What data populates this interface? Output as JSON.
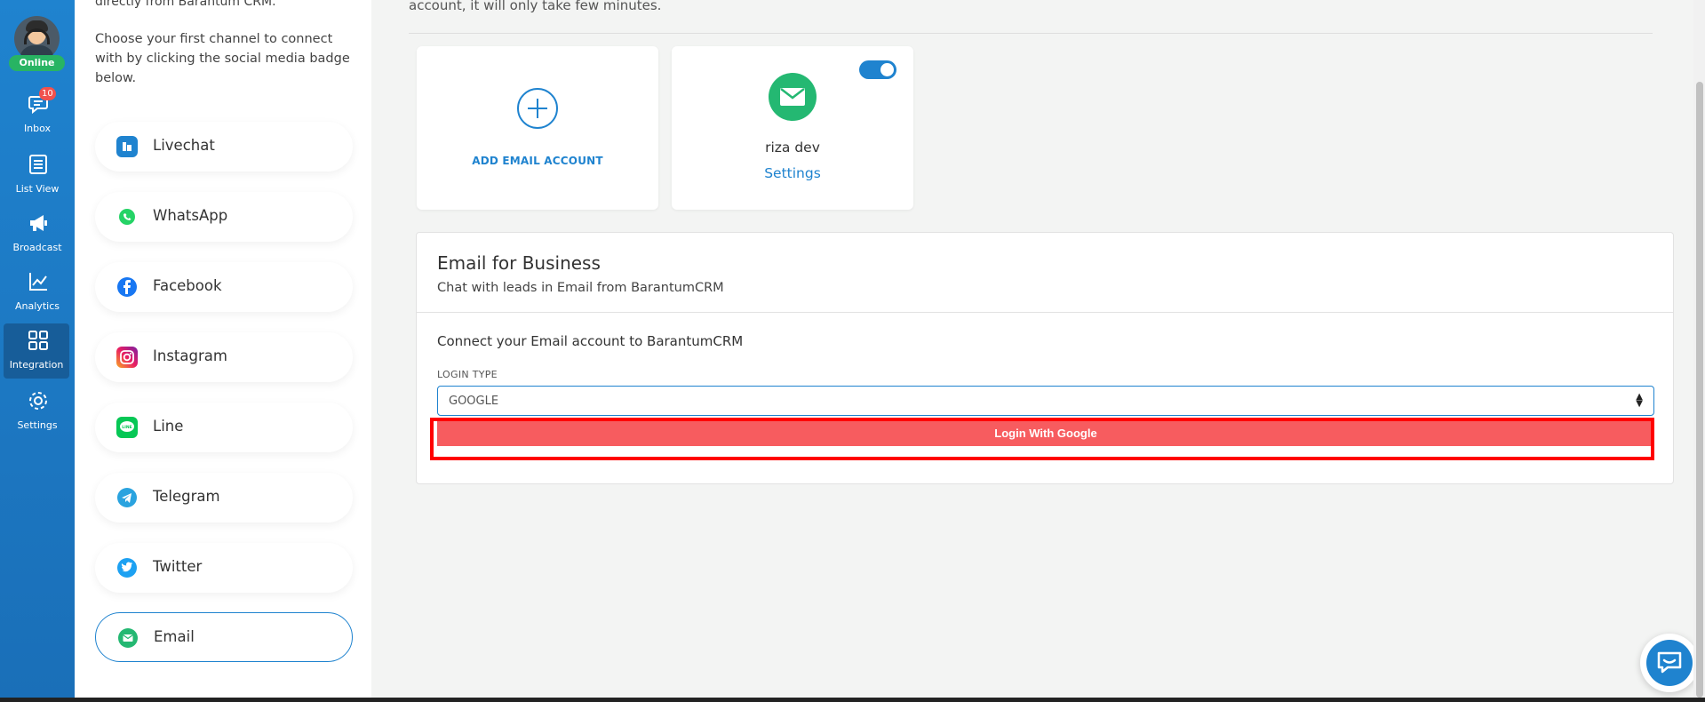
{
  "rail": {
    "status": "Online",
    "items": [
      {
        "label": "Inbox",
        "icon": "chat-bubble-icon",
        "badge": "10"
      },
      {
        "label": "List View",
        "icon": "list-icon"
      },
      {
        "label": "Broadcast",
        "icon": "megaphone-icon"
      },
      {
        "label": "Analytics",
        "icon": "line-chart-icon"
      },
      {
        "label": "Integration",
        "icon": "grid-icon",
        "active": true
      },
      {
        "label": "Settings",
        "icon": "gear-icon"
      }
    ]
  },
  "panel": {
    "intro_top": "directly from Barantum CRM.",
    "intro": "Choose your first channel to connect with by clicking the social media badge below.",
    "channels": [
      {
        "label": "Livechat",
        "icon": "livechat-icon"
      },
      {
        "label": "WhatsApp",
        "icon": "whatsapp-icon"
      },
      {
        "label": "Facebook",
        "icon": "facebook-icon"
      },
      {
        "label": "Instagram",
        "icon": "instagram-icon"
      },
      {
        "label": "Line",
        "icon": "line-app-icon"
      },
      {
        "label": "Telegram",
        "icon": "telegram-icon"
      },
      {
        "label": "Twitter",
        "icon": "twitter-icon"
      },
      {
        "label": "Email",
        "icon": "email-icon",
        "selected": true
      }
    ]
  },
  "main": {
    "intro": "account, it will only take few minutes.",
    "add_card": {
      "label": "ADD EMAIL ACCOUNT"
    },
    "account_card": {
      "name": "riza dev",
      "settings_link": "Settings",
      "enabled": true
    },
    "business": {
      "title": "Email for Business",
      "subtitle": "Chat with leads in Email from BarantumCRM",
      "connect_heading": "Connect your Email account to BarantumCRM",
      "login_type_label": "LOGIN TYPE",
      "login_type_value": "GOOGLE",
      "login_button": "Login With Google"
    }
  },
  "colors": {
    "rail": "#1f83cf",
    "accent": "#1f83cf",
    "online": "#28b463",
    "email_green": "#24b872",
    "login_button": "#f75c5f",
    "highlight": "#ff0000"
  }
}
